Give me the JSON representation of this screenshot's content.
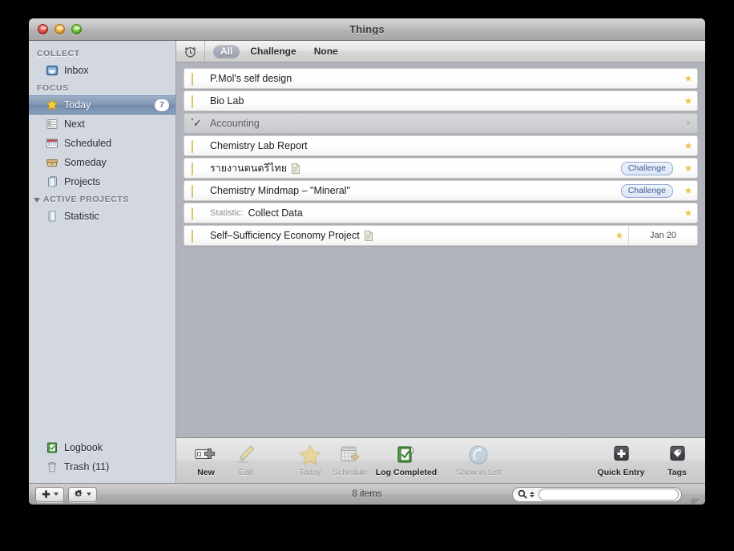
{
  "window": {
    "title": "Things",
    "traffic": {
      "close": "close-button",
      "minimize": "minimize-button",
      "zoom": "zoom-button"
    }
  },
  "sidebar": {
    "sections": [
      {
        "header": "COLLECT",
        "collapsible": false,
        "items": [
          {
            "label": "Inbox",
            "icon": "inbox-icon",
            "badge": "",
            "selected": false
          }
        ]
      },
      {
        "header": "FOCUS",
        "collapsible": false,
        "items": [
          {
            "label": "Today",
            "icon": "star-icon",
            "badge": "7",
            "selected": true
          },
          {
            "label": "Next",
            "icon": "next-icon",
            "badge": "",
            "selected": false
          },
          {
            "label": "Scheduled",
            "icon": "calendar-icon",
            "badge": "",
            "selected": false
          },
          {
            "label": "Someday",
            "icon": "box-icon",
            "badge": "",
            "selected": false
          },
          {
            "label": "Projects",
            "icon": "projects-icon",
            "badge": "",
            "selected": false
          }
        ]
      },
      {
        "header": "ACTIVE PROJECTS",
        "collapsible": true,
        "items": [
          {
            "label": "Statistic",
            "icon": "project-icon",
            "badge": "",
            "selected": false
          }
        ]
      }
    ],
    "bottom_items": [
      {
        "label": "Logbook",
        "icon": "logbook-icon"
      },
      {
        "label": "Trash (11)",
        "icon": "trash-icon"
      }
    ]
  },
  "filterbar": {
    "clock_icon": "alarm-clock-icon",
    "tags": [
      {
        "label": "All",
        "active": true
      },
      {
        "label": "Challenge",
        "active": false
      },
      {
        "label": "None",
        "active": false
      }
    ]
  },
  "list": {
    "rows": [
      {
        "title": "P.Mol's self design",
        "project": "",
        "done": false,
        "note": false,
        "tag": "",
        "star": "starred",
        "date": ""
      },
      {
        "title": "Bio Lab",
        "project": "",
        "done": false,
        "note": false,
        "tag": "",
        "star": "starred",
        "date": ""
      },
      {
        "title": "Accounting",
        "project": "",
        "done": true,
        "note": false,
        "tag": "",
        "star": "dim",
        "date": ""
      },
      {
        "title": "Chemistry Lab Report",
        "project": "",
        "done": false,
        "note": false,
        "tag": "",
        "star": "starred",
        "date": ""
      },
      {
        "title": "รายงานดนตรีไทย",
        "project": "",
        "done": false,
        "note": true,
        "tag": "Challenge",
        "star": "starred",
        "date": ""
      },
      {
        "title": "Chemistry Mindmap – \"Mineral\"",
        "project": "",
        "done": false,
        "note": false,
        "tag": "Challenge",
        "star": "starred",
        "date": ""
      },
      {
        "title": "Collect Data",
        "project": "Statistic:",
        "done": false,
        "note": false,
        "tag": "",
        "star": "starred",
        "date": ""
      },
      {
        "title": "Self–Sufficiency Economy Project",
        "project": "",
        "done": false,
        "note": true,
        "tag": "",
        "star": "starred",
        "date": "Jan 20"
      }
    ]
  },
  "toolbar": {
    "buttons": [
      {
        "label": "New",
        "icon": "new-item-icon",
        "disabled": false
      },
      {
        "label": "Edit",
        "icon": "pencil-icon",
        "disabled": true
      },
      {
        "label": "Today",
        "icon": "star-icon",
        "disabled": true
      },
      {
        "label": "Schedule",
        "icon": "calendar-arrow-icon",
        "disabled": true
      },
      {
        "label": "Log Completed",
        "icon": "logbook-check-icon",
        "disabled": false
      },
      {
        "label": "Show in List",
        "icon": "back-arrow-icon",
        "disabled": true
      },
      {
        "label": "Quick Entry",
        "icon": "plus-square-icon",
        "disabled": false
      },
      {
        "label": "Tags",
        "icon": "tag-icon",
        "disabled": false
      }
    ]
  },
  "statusbar": {
    "add_button": "add-button",
    "action_button": "action-gear-button",
    "item_count": "8 items",
    "search_icon": "search-icon",
    "search_value": "",
    "search_placeholder": "",
    "resize_grip": "resize-grip"
  }
}
